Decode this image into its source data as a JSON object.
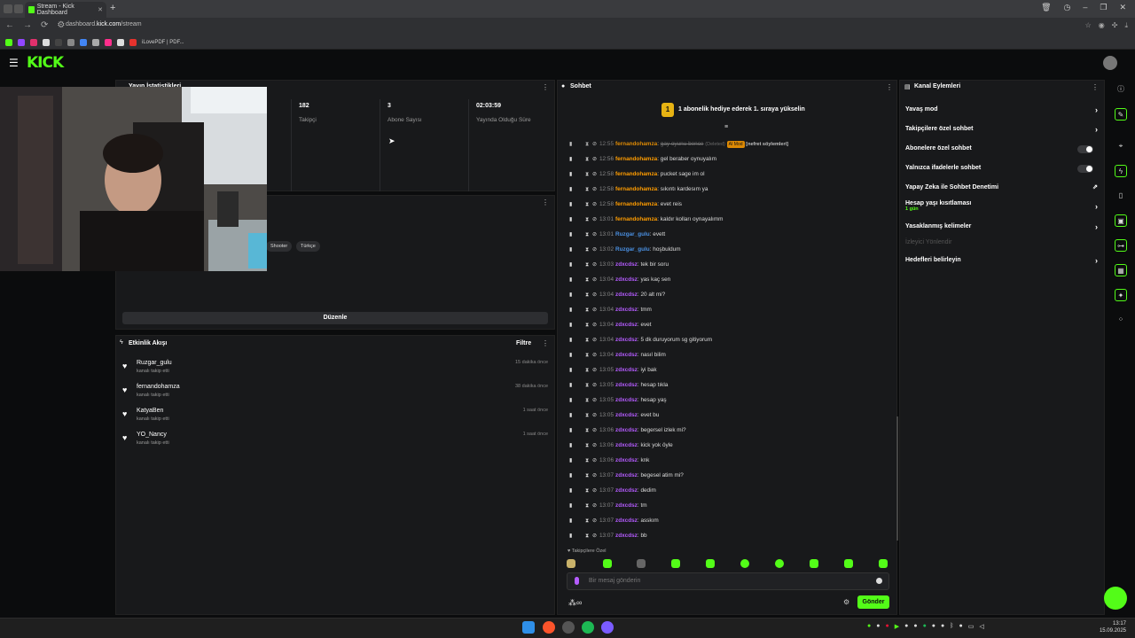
{
  "browser": {
    "tab_title": "Stream - Kick Dashboard",
    "url_prefix": "dashboard.",
    "url_domain": "kick.com",
    "url_path": "/stream",
    "bookmark_label": "iLovePDF | PDF..."
  },
  "header": {
    "logo": "KICK"
  },
  "stats": {
    "title": "Yayın İstatistikleri",
    "items": [
      {
        "value": "182",
        "label": "Takipçi"
      },
      {
        "value": "3",
        "label": "Abone Sayısı"
      },
      {
        "value": "02:03:59",
        "label": "Yayında Olduğu Süre"
      }
    ]
  },
  "info": {
    "tags": [
      "Shooter",
      "Türkçe"
    ],
    "edit_label": "Düzenle"
  },
  "activity": {
    "title": "Etkinlik Akışı",
    "filter_label": "Filtre",
    "items": [
      {
        "name": "Ruzgar_gulu",
        "sub": "kanalı takip etti",
        "time": "15 dakika önce"
      },
      {
        "name": "fernandohamza",
        "sub": "kanalı takip etti",
        "time": "38 dakika önce"
      },
      {
        "name": "KatyaBen",
        "sub": "kanalı takip etti",
        "time": "1 saat önce"
      },
      {
        "name": "YO_Nancy",
        "sub": "kanalı takip etti",
        "time": "1 saat önce"
      }
    ]
  },
  "chat": {
    "title": "Sohbet",
    "banner": "1 abonelik hediye ederek 1. sıraya yükselin",
    "banner_rank": "1",
    "deleted_label": "(Deleted)",
    "badge_label": "AI Mod",
    "deleted_note": "[nefret söylemleri]",
    "messages": [
      {
        "time": "12:55",
        "user": "fernandohamza",
        "text": "gay oyunu bence",
        "color": "#ff9d00",
        "deleted": true
      },
      {
        "time": "12:56",
        "user": "fernandohamza",
        "text": "gel beraber oynuyalım",
        "color": "#ff9d00"
      },
      {
        "time": "12:58",
        "user": "fernandohamza",
        "text": "pucket sage im ol",
        "color": "#ff9d00"
      },
      {
        "time": "12:58",
        "user": "fernandohamza",
        "text": "sıkıntı kardesım ya",
        "color": "#ff9d00"
      },
      {
        "time": "12:58",
        "user": "fernandohamza",
        "text": "evet reis",
        "color": "#ff9d00"
      },
      {
        "time": "13:01",
        "user": "fernandohamza",
        "text": "kaldır kolları oynayalımm",
        "color": "#ff9d00"
      },
      {
        "time": "13:01",
        "user": "Ruzgar_gulu",
        "text": "evett",
        "color": "#4a90e2"
      },
      {
        "time": "13:02",
        "user": "Ruzgar_gulu",
        "text": "hoşbuldum",
        "color": "#4a90e2"
      },
      {
        "time": "13:03",
        "user": "zdxcdsz",
        "text": "tek bir soru",
        "color": "#b55cff"
      },
      {
        "time": "13:04",
        "user": "zdxcdsz",
        "text": "yas kaç sen",
        "color": "#b55cff"
      },
      {
        "time": "13:04",
        "user": "zdxcdsz",
        "text": "20 alt mi?",
        "color": "#b55cff"
      },
      {
        "time": "13:04",
        "user": "zdxcdsz",
        "text": "tmm",
        "color": "#b55cff"
      },
      {
        "time": "13:04",
        "user": "zdxcdsz",
        "text": "evet",
        "color": "#b55cff"
      },
      {
        "time": "13:04",
        "user": "zdxcdsz",
        "text": "5 dk duruyorum sg gitiyorum",
        "color": "#b55cff"
      },
      {
        "time": "13:04",
        "user": "zdxcdsz",
        "text": "nasıl bilim",
        "color": "#b55cff"
      },
      {
        "time": "13:05",
        "user": "zdxcdsz",
        "text": "iyi bak",
        "color": "#b55cff"
      },
      {
        "time": "13:05",
        "user": "zdxcdsz",
        "text": "hesap tıkla",
        "color": "#b55cff"
      },
      {
        "time": "13:05",
        "user": "zdxcdsz",
        "text": "hesap yaş",
        "color": "#b55cff"
      },
      {
        "time": "13:05",
        "user": "zdxcdsz",
        "text": "evet bu",
        "color": "#b55cff"
      },
      {
        "time": "13:06",
        "user": "zdxcdsz",
        "text": "begersel izlek mi?",
        "color": "#b55cff"
      },
      {
        "time": "13:06",
        "user": "zdxcdsz",
        "text": "kick yok öyle",
        "color": "#b55cff"
      },
      {
        "time": "13:06",
        "user": "zdxcdsz",
        "text": "knk",
        "color": "#b55cff"
      },
      {
        "time": "13:07",
        "user": "zdxcdsz",
        "text": "begesel atim mi?",
        "color": "#b55cff"
      },
      {
        "time": "13:07",
        "user": "zdxcdsz",
        "text": "dedim",
        "color": "#b55cff"
      },
      {
        "time": "13:07",
        "user": "zdxcdsz",
        "text": "tm",
        "color": "#b55cff"
      },
      {
        "time": "13:07",
        "user": "zdxcdsz",
        "text": "asskım",
        "color": "#b55cff"
      },
      {
        "time": "13:07",
        "user": "zdxcdsz",
        "text": "bb",
        "color": "#b55cff"
      }
    ],
    "emote_title": "Takipçilere Özel",
    "input_placeholder": "Bir mesaj gönderin",
    "send_label": "Gönder",
    "bottom_left": "∞"
  },
  "actions": {
    "title": "Kanal Eylemleri",
    "rows": [
      {
        "label": "Yavaş mod",
        "type": "chevron"
      },
      {
        "label": "Takipçilere özel sohbet",
        "type": "chevron"
      },
      {
        "label": "Abonelere özel sohbet",
        "type": "toggle"
      },
      {
        "label": "Yalnızca ifadelerle sohbet",
        "type": "toggle"
      },
      {
        "label": "Yapay Zeka ile Sohbet Denetimi",
        "type": "external"
      },
      {
        "label": "Hesap yaşı kısıtlaması",
        "type": "chevron",
        "sub": "1 gün"
      },
      {
        "label": "Yasaklanmış kelimeler",
        "type": "chevron"
      },
      {
        "label": "İzleyici Yönlendir",
        "type": "disabled"
      },
      {
        "label": "Hedefleri belirleyin",
        "type": "chevron"
      }
    ]
  },
  "taskbar": {
    "time": "13:17",
    "date": "15.09.2025"
  },
  "colors": {
    "accent": "#53fc18",
    "panel": "#18191b",
    "background": "#0b0c0d"
  }
}
